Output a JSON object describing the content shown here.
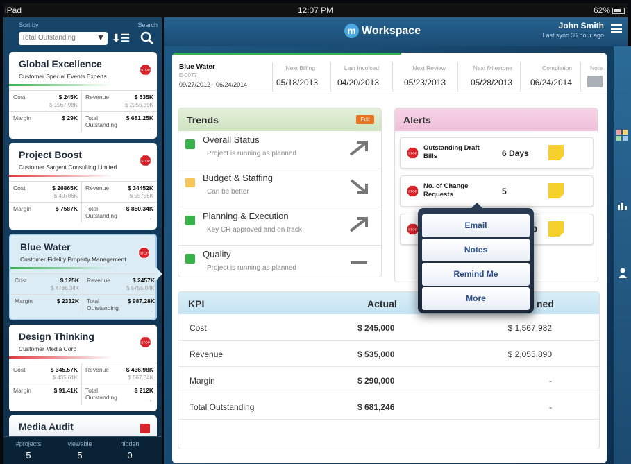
{
  "status_bar": {
    "device": "iPad",
    "time": "12:07 PM",
    "battery": "62%"
  },
  "sidebar": {
    "sort_label": "Sort by",
    "search_label": "Search",
    "sort_value": "Total Outstanding",
    "projects": [
      {
        "name": "Global Excellence",
        "customer": "Customer Special Events Experts",
        "bar_color": "#37b34a",
        "cost": "$ 245K",
        "cost_sub": "$ 1567.98K",
        "revenue": "$ 535K",
        "revenue_sub": "$ 2055.89K",
        "margin": "$ 29K",
        "total_outstanding": "$ 681.25K",
        "cost_label": "Cost",
        "revenue_label": "Revenue",
        "margin_label": "Margin",
        "total_label": "Total",
        "outstanding_label": "Outstanding",
        "dash": "-"
      },
      {
        "name": "Project Boost",
        "customer": "Customer Sargent Consulting Limited",
        "bar_color": "#e0393e",
        "cost": "$ 26865K",
        "cost_sub": "$ 40786K",
        "revenue": "$ 34452K",
        "revenue_sub": "$ 55756K",
        "margin": "$ 7587K",
        "total_outstanding": "$ 850.34K",
        "cost_label": "Cost",
        "revenue_label": "Revenue",
        "margin_label": "Margin",
        "total_label": "Total",
        "outstanding_label": "Outstanding",
        "dash": "-"
      },
      {
        "name": "Blue Water",
        "customer": "Customer Fidelity Property Management",
        "bar_color": "#37b34a",
        "cost": "$ 125K",
        "cost_sub": "$ 4786.34K",
        "revenue": "$ 2457K",
        "revenue_sub": "$ 5755.04K",
        "margin": "$ 2332K",
        "total_outstanding": "$ 987.28K",
        "cost_label": "Cost",
        "revenue_label": "Revenue",
        "margin_label": "Margin",
        "total_label": "Total",
        "outstanding_label": "Outstanding",
        "dash": "-"
      },
      {
        "name": "Design Thinking",
        "customer": "Customer Media Corp",
        "bar_color": "#e0393e",
        "cost": "$ 345.57K",
        "cost_sub": "$ 435.61K",
        "revenue": "$ 436.98K",
        "revenue_sub": "$ 567.34K",
        "margin": "$ 91.41K",
        "total_outstanding": "$ 212K",
        "cost_label": "Cost",
        "revenue_label": "Revenue",
        "margin_label": "Margin",
        "total_label": "Total",
        "outstanding_label": "Outstanding",
        "dash": "-"
      },
      {
        "name": "Media Audit"
      }
    ],
    "stats": [
      {
        "label": "#projects",
        "value": "5"
      },
      {
        "label": "viewable",
        "value": "5"
      },
      {
        "label": "hidden",
        "value": "0"
      }
    ]
  },
  "header": {
    "app_name": "Workspace",
    "logo_letter": "m",
    "user": "John Smith",
    "sync": "Last sync 36 hour ago"
  },
  "project": {
    "name": "Blue Water",
    "id": "E-0077",
    "dates": "09/27/2012 - 06/24/2014",
    "milestones": [
      {
        "label": "Next Billing",
        "value": "05/18/2013"
      },
      {
        "label": "Last Invoiced",
        "value": "04/20/2013"
      },
      {
        "label": "Next Review",
        "value": "05/23/2013"
      },
      {
        "label": "Next Milestone",
        "value": "05/28/2013"
      },
      {
        "label": "Completion",
        "value": "06/24/2014"
      }
    ],
    "note_label": "Note"
  },
  "trends": {
    "title": "Trends",
    "edit_label": "Edit",
    "items": [
      {
        "name": "Overall Status",
        "desc": "Project is running as planned",
        "color": "#37b34a",
        "trend": "up"
      },
      {
        "name": "Budget & Staffing",
        "desc": "Can be better",
        "color": "#f7c65a",
        "trend": "down"
      },
      {
        "name": "Planning & Execution",
        "desc": "Key CR approved and on track",
        "color": "#37b34a",
        "trend": "up"
      },
      {
        "name": "Quality",
        "desc": "Project is running as planned",
        "color": "#37b34a",
        "trend": "flat"
      }
    ]
  },
  "alerts": {
    "title": "Alerts",
    "items": [
      {
        "text": "Outstanding Draft Bills",
        "value": "6 Days"
      },
      {
        "text": "No. of Change Requests",
        "value": "5"
      },
      {
        "text": "",
        "value": "0"
      }
    ]
  },
  "popover": {
    "items": [
      "Email",
      "Notes",
      "Remind Me",
      "More"
    ]
  },
  "kpi": {
    "headers": {
      "kpi": "KPI",
      "actual": "Actual",
      "planned": "Planned",
      "planned_visible": "ned"
    },
    "rows": [
      {
        "name": "Cost",
        "actual": "$ 245,000",
        "planned": "$ 1,567,982"
      },
      {
        "name": "Revenue",
        "actual": "$ 535,000",
        "planned": "$ 2,055,890"
      },
      {
        "name": "Margin",
        "actual": "$ 290,000",
        "planned": "-"
      },
      {
        "name": "Total Outstanding",
        "actual": "$ 681,246",
        "planned": "-"
      }
    ]
  },
  "icons": {
    "sort": "sort-descending-icon",
    "search": "search-icon",
    "stop": "stop-sign-icon",
    "note": "note-icon",
    "menu": "hamburger-menu-icon"
  }
}
